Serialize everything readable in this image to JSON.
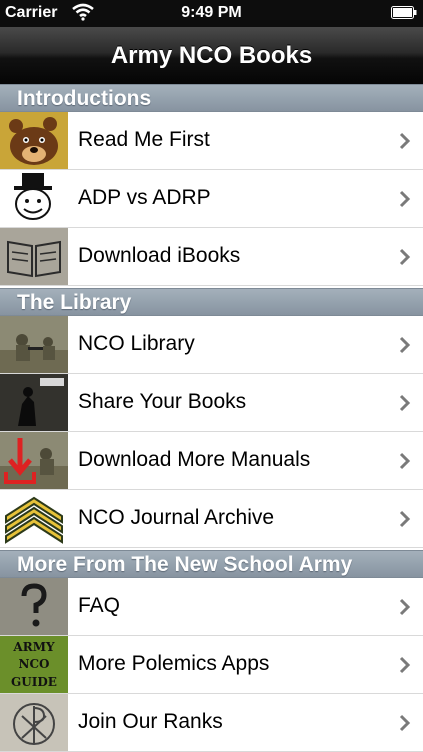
{
  "status_bar": {
    "carrier": "Carrier",
    "time": "9:49 PM"
  },
  "nav": {
    "title": "Army NCO Books"
  },
  "sections": [
    {
      "title": "Introductions",
      "items": [
        {
          "label": "Read Me First",
          "icon": "bear-icon"
        },
        {
          "label": "ADP vs ADRP",
          "icon": "top-hat-face-icon"
        },
        {
          "label": "Download iBooks",
          "icon": "open-book-icon"
        }
      ]
    },
    {
      "title": "The Library",
      "items": [
        {
          "label": "NCO Library",
          "icon": "soldiers-photo-icon"
        },
        {
          "label": "Share Your Books",
          "icon": "manual-cover-icon"
        },
        {
          "label": "Download More Manuals",
          "icon": "download-arrow-photo-icon"
        },
        {
          "label": "NCO Journal Archive",
          "icon": "sergeant-chevron-icon"
        }
      ]
    },
    {
      "title": "More From The New School Army",
      "items": [
        {
          "label": "FAQ",
          "icon": "question-mark-icon"
        },
        {
          "label": "More Polemics Apps",
          "icon": "army-nco-guide-icon",
          "icon_text": [
            "ARMY",
            "NCO",
            "GUIDE"
          ]
        },
        {
          "label": "Join Our Ranks",
          "icon": "chi-rho-icon"
        }
      ]
    }
  ],
  "colors": {
    "nav_bg": "#111111",
    "section_header_bg": "#95a2ae",
    "chevron": "#7a7a7a"
  }
}
